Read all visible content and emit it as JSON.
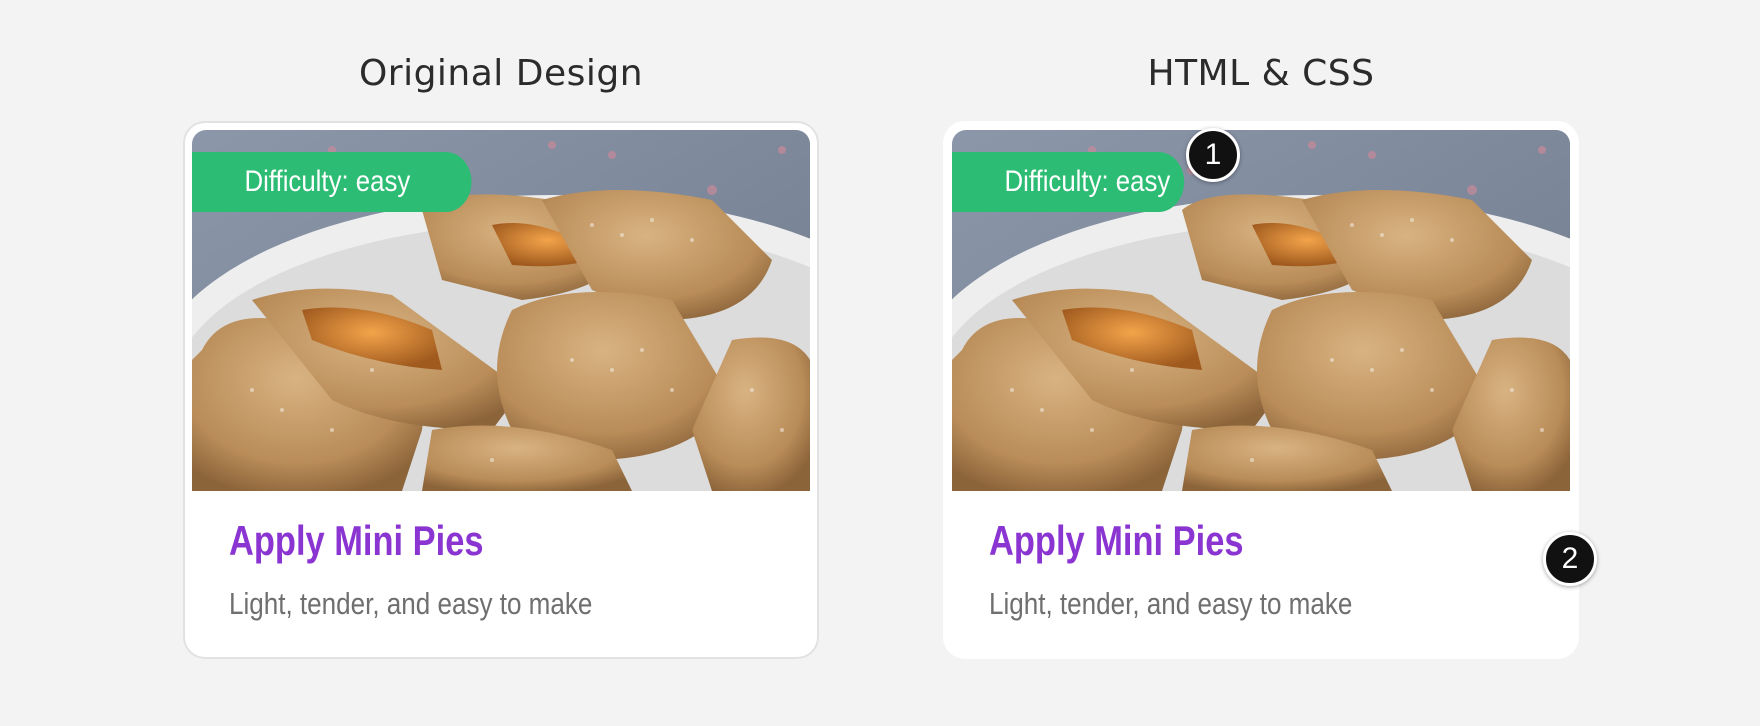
{
  "panels": [
    {
      "heading": "Original Design",
      "card": {
        "badge": "Difficulty: easy",
        "title": "Apply Mini Pies",
        "subtitle": "Light, tender, and easy to make"
      }
    },
    {
      "heading": "HTML & CSS",
      "card": {
        "badge": "Difficulty: easy",
        "title": "Apply Mini Pies",
        "subtitle": "Light, tender, and easy to make"
      }
    }
  ],
  "markers": [
    "1",
    "2"
  ],
  "colors": {
    "page_background": "#f3f3f3",
    "badge_green": "#2cbc73",
    "title_purple": "#8a35d2",
    "subtitle_gray": "#6f6f6f",
    "marker_black": "#111111"
  },
  "icons": {
    "card_image": "pastry-photo",
    "markers": "numbered-callout-marker"
  }
}
